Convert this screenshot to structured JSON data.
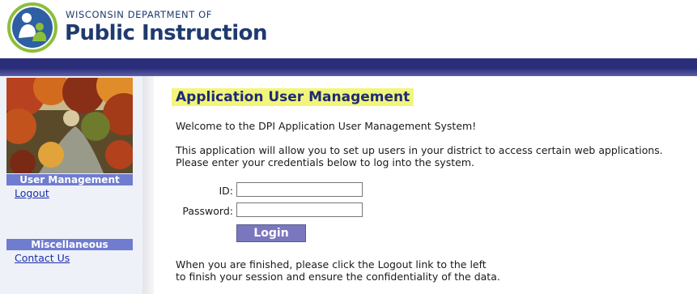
{
  "header": {
    "org_line": "WISCONSIN DEPARTMENT OF",
    "org_name": "Public Instruction"
  },
  "sidebar": {
    "sections": [
      {
        "heading": "User Management",
        "links": [
          "Logout"
        ]
      },
      {
        "heading": "Miscellaneous",
        "links": [
          "Contact Us"
        ]
      }
    ]
  },
  "main": {
    "title": "Application User Management",
    "welcome": "Welcome to the DPI Application User Management System!",
    "intro_line1": "This application will allow you to set up users in your district to access certain web applications.",
    "intro_line2": "Please enter your credentials below to log into the system.",
    "form": {
      "id_label": "ID:",
      "id_value": "",
      "password_label": "Password:",
      "password_value": "",
      "login_label": "Login"
    },
    "footer_line1": "When you are finished, please click the Logout link to the left",
    "footer_line2": "to finish your session and ensure the confidentiality of the data."
  },
  "colors": {
    "header_bar": "#2a2e7a",
    "sidebar_heading": "#6f7ccf",
    "title_highlight": "#f3f57a",
    "title_text": "#1d2b75",
    "link": "#1b2fa8",
    "login_button": "#7b77bf"
  },
  "icons": [
    "dpi-logo-icon",
    "autumn-photo"
  ]
}
